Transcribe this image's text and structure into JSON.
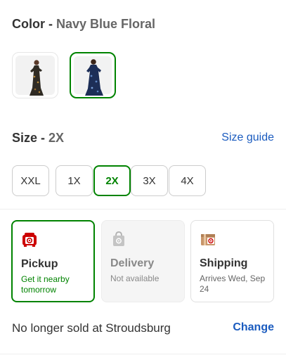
{
  "color": {
    "label": "Color",
    "separator": " - ",
    "selected": "Navy Blue Floral"
  },
  "swatches": [
    {
      "name": "Black Floral",
      "selected": false
    },
    {
      "name": "Navy Blue Floral",
      "selected": true
    }
  ],
  "size": {
    "label": "Size",
    "separator": " - ",
    "selected": "2X",
    "guide_link": "Size guide"
  },
  "sizes": [
    {
      "label": "XXL",
      "selected": false
    },
    {
      "label": "1X",
      "selected": false
    },
    {
      "label": "2X",
      "selected": true
    },
    {
      "label": "3X",
      "selected": false
    },
    {
      "label": "4X",
      "selected": false
    }
  ],
  "fulfillment": {
    "pickup": {
      "title": "Pickup",
      "subtitle": "Get it nearby tomorrow",
      "icon": "store-pickup-icon",
      "selected": true
    },
    "delivery": {
      "title": "Delivery",
      "subtitle": "Not available",
      "icon": "delivery-bag-icon",
      "disabled": true
    },
    "shipping": {
      "title": "Shipping",
      "subtitle": "Arrives Wed, Sep 24",
      "icon": "shipping-box-icon"
    }
  },
  "store": {
    "message": "No longer sold at Stroudsburg",
    "change_label": "Change"
  },
  "colors": {
    "accent_green": "#008300",
    "link_blue": "#1a5bbf",
    "brand_red": "#cc0000"
  }
}
